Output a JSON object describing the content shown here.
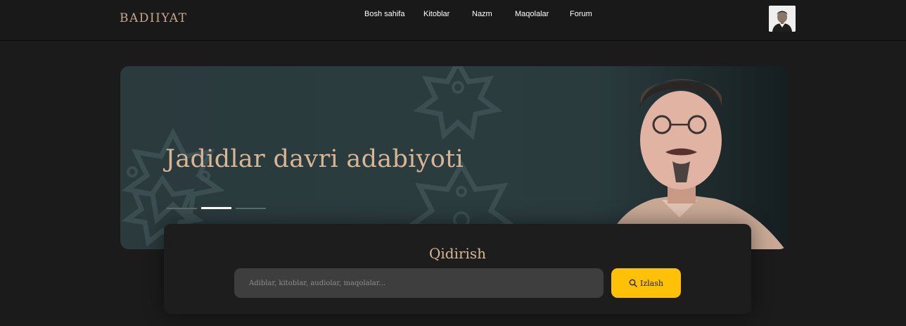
{
  "brand": {
    "logo_text": "Badiiyat"
  },
  "nav": {
    "items": [
      {
        "label": "Bosh sahifa"
      },
      {
        "label": "Kitoblar"
      },
      {
        "label": "Nazm"
      },
      {
        "label": "Maqolalar"
      },
      {
        "label": "Forum"
      }
    ]
  },
  "user": {
    "avatar_icon": "user-avatar"
  },
  "hero": {
    "title": "Jadidlar davri adabiyoti",
    "slides_total": 3,
    "active_slide": 2,
    "image_icon": "portrait-photo"
  },
  "search": {
    "title": "Qidirish",
    "placeholder": "Adiblar, kitoblar, audiolar, maqolalar...",
    "value": "",
    "button_label": "Izlash",
    "button_icon": "search-icon"
  },
  "colors": {
    "accent": "#d8b796",
    "button": "#ffc107",
    "background": "#1b1b1b",
    "hero_bg": "#2b3c3f"
  }
}
